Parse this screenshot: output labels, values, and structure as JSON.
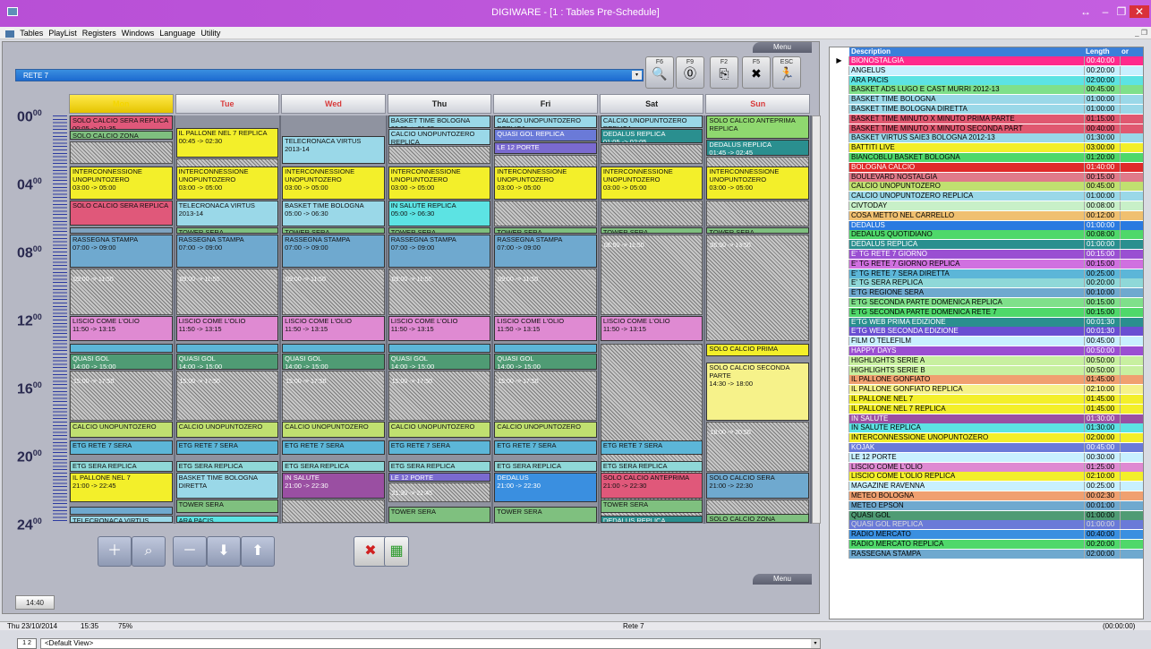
{
  "window": {
    "title": "DIGIWARE - [1 : Tables Pre-Schedule]",
    "min": "–",
    "max": "❐",
    "close": "✕",
    "restore": "↔"
  },
  "menu": [
    "Tables",
    "PlayList",
    "Registers",
    "Windows",
    "Language",
    "Utility"
  ],
  "mdi": "_ ❐",
  "menu_tab": "Menu",
  "channel": "RETE 7",
  "fbuttons": [
    {
      "key": "F6",
      "icon": "🔍"
    },
    {
      "key": "F9",
      "icon": "⓪"
    },
    {
      "key": "F2",
      "icon": "⎘"
    },
    {
      "key": "F5",
      "icon": "✖"
    },
    {
      "key": "ESC",
      "icon": "🏃"
    }
  ],
  "days": [
    "Mon",
    "Tue",
    "Wed",
    "Thu",
    "Fri",
    "Sat",
    "Sun"
  ],
  "day_colors": [
    "#f4d600",
    "#d83b3b",
    "#d83b3b",
    "#222222",
    "#222222",
    "#222222",
    "#d83b3b"
  ],
  "hours": [
    "00",
    "04",
    "08",
    "12",
    "16",
    "20",
    "24"
  ],
  "hour_sup": "00",
  "schedule": [
    [
      {
        "s": 0,
        "e": 0.9,
        "t": "SOLO CALCIO SERA REPLICA",
        "sub": "00:05 -> 01:35",
        "c": "#e0587a"
      },
      {
        "s": 0.9,
        "e": 1.5,
        "t": "SOLO CALCIO ZONA",
        "c": "#7fc07f"
      },
      {
        "s": 1.5,
        "e": 2.9,
        "h": true
      },
      {
        "s": 3,
        "e": 5,
        "t": "INTERCONNESSIONE UNOPUNTOZERO",
        "sub": "03:00 -> 05:00",
        "c": "#f3ef2a"
      },
      {
        "s": 5,
        "e": 6.5,
        "t": "SOLO CALCIO SERA REPLICA",
        "c": "#e0587a"
      },
      {
        "s": 6.6,
        "e": 7,
        "t": "",
        "c": "#7fa3c0"
      },
      {
        "s": 7,
        "e": 9,
        "t": "RASSEGNA STAMPA",
        "sub": "07:00 -> 09:00",
        "c": "#6fa9cf"
      },
      {
        "s": 9,
        "e": 11.8,
        "h": true,
        "ht": "09:00 -> 11:50"
      },
      {
        "s": 11.8,
        "e": 13.3,
        "t": "LISCIO COME L'OLIO",
        "sub": "11:50 -> 13:15",
        "c": "#df8ad2"
      },
      {
        "s": 13.4,
        "e": 14,
        "t": "",
        "c": "#5cb6d8"
      },
      {
        "s": 14,
        "e": 15,
        "t": "QUASI GOL",
        "sub": "14:00 -> 15:00",
        "c": "#4f9b74"
      },
      {
        "s": 15,
        "e": 18,
        "h": true,
        "ht": "15:00 -> 17:50"
      },
      {
        "s": 18,
        "e": 19,
        "t": "CALCIO UNOPUNTOZERO",
        "c": "#c0e070"
      },
      {
        "s": 19.1,
        "e": 20,
        "t": "ETG RETE 7 SERA",
        "c": "#5cb6d8"
      },
      {
        "s": 20.3,
        "e": 21,
        "t": "ETG SERA REPLICA",
        "c": "#8fd8d8"
      },
      {
        "s": 21,
        "e": 22.8,
        "t": "IL PALLONE NEL 7",
        "sub": "21:00 -> 22:45",
        "c": "#f3ef2a"
      },
      {
        "s": 23,
        "e": 23.5,
        "t": "",
        "c": "#6fa9cf"
      },
      {
        "s": 23.5,
        "e": 24,
        "t": "TELECRONACA VIRTUS",
        "c": "#9ad8e8"
      }
    ],
    [
      {
        "s": 0.75,
        "e": 2.5,
        "t": "IL PALLONE NEL 7 REPLICA",
        "sub": "00:45 -> 02:30",
        "c": "#f3ef2a"
      },
      {
        "s": 2.5,
        "e": 2.9,
        "h": true
      },
      {
        "s": 3,
        "e": 5,
        "t": "INTERCONNESSIONE UNOPUNTOZERO",
        "sub": "03:00 -> 05:00",
        "c": "#f3ef2a"
      },
      {
        "s": 5,
        "e": 6.6,
        "t": "TELECRONACA VIRTUS",
        "sub": "2013-14",
        "c": "#9ad8e8"
      },
      {
        "s": 6.6,
        "e": 7,
        "t": "TOWER SERA",
        "c": "#7fc07f"
      },
      {
        "s": 7,
        "e": 9,
        "t": "RASSEGNA STAMPA",
        "sub": "07:00 -> 09:00",
        "c": "#6fa9cf"
      },
      {
        "s": 9,
        "e": 11.8,
        "h": true,
        "ht": "09:00 -> 11:50"
      },
      {
        "s": 11.8,
        "e": 13.3,
        "t": "LISCIO COME L'OLIO",
        "sub": "11:50 -> 13:15",
        "c": "#df8ad2"
      },
      {
        "s": 13.4,
        "e": 14,
        "t": "",
        "c": "#5cb6d8"
      },
      {
        "s": 14,
        "e": 15,
        "t": "QUASI GOL",
        "sub": "14:00 -> 15:00",
        "c": "#4f9b74"
      },
      {
        "s": 15,
        "e": 18,
        "h": true,
        "ht": "15:00 -> 17:50"
      },
      {
        "s": 18,
        "e": 19,
        "t": "CALCIO UNOPUNTOZERO",
        "c": "#c0e070"
      },
      {
        "s": 19.1,
        "e": 20,
        "t": "ETG RETE 7 SERA",
        "c": "#5cb6d8"
      },
      {
        "s": 20.3,
        "e": 21,
        "t": "ETG SERA REPLICA",
        "c": "#8fd8d8"
      },
      {
        "s": 21,
        "e": 22.6,
        "t": "BASKET TIME BOLOGNA DIRETTA",
        "c": "#9ad8e8"
      },
      {
        "s": 22.6,
        "e": 23.4,
        "t": "TOWER SERA",
        "c": "#7fc07f"
      },
      {
        "s": 23.5,
        "e": 24,
        "t": "ARA PACIS",
        "c": "#5ce3e3"
      }
    ],
    [
      {
        "s": 1.2,
        "e": 2.9,
        "t": "TELECRONACA VIRTUS",
        "sub": "2013-14",
        "c": "#9ad8e8"
      },
      {
        "s": 3,
        "e": 5,
        "t": "INTERCONNESSIONE UNOPUNTOZERO",
        "sub": "03:00 -> 05:00",
        "c": "#f3ef2a"
      },
      {
        "s": 5,
        "e": 6.6,
        "t": "BASKET TIME BOLOGNA",
        "sub": "05:00 -> 06:30",
        "c": "#9ad8e8"
      },
      {
        "s": 6.6,
        "e": 7,
        "t": "TOWER SERA",
        "c": "#7fc07f"
      },
      {
        "s": 7,
        "e": 9,
        "t": "RASSEGNA STAMPA",
        "sub": "07:00 -> 09:00",
        "c": "#6fa9cf"
      },
      {
        "s": 9,
        "e": 11.8,
        "h": true,
        "ht": "09:00 -> 11:50"
      },
      {
        "s": 11.8,
        "e": 13.3,
        "t": "LISCIO COME L'OLIO",
        "sub": "11:50 -> 13:15",
        "c": "#df8ad2"
      },
      {
        "s": 13.4,
        "e": 14,
        "t": "",
        "c": "#5cb6d8"
      },
      {
        "s": 14,
        "e": 15,
        "t": "QUASI GOL",
        "sub": "14:00 -> 15:00",
        "c": "#4f9b74"
      },
      {
        "s": 15,
        "e": 18,
        "h": true,
        "ht": "15:00 -> 17:50"
      },
      {
        "s": 18,
        "e": 19,
        "t": "CALCIO UNOPUNTOZERO",
        "c": "#c0e070"
      },
      {
        "s": 19.1,
        "e": 20,
        "t": "ETG RETE 7 SERA",
        "c": "#5cb6d8"
      },
      {
        "s": 20.3,
        "e": 21,
        "t": "ETG SERA REPLICA",
        "c": "#8fd8d8"
      },
      {
        "s": 21,
        "e": 22.6,
        "t": "IN SALUTE",
        "sub": "21:00 -> 22:30",
        "c": "#9a4fa2"
      },
      {
        "s": 22.6,
        "e": 24,
        "h": true
      }
    ],
    [
      {
        "s": 0,
        "e": 0.8,
        "t": "BASKET TIME BOLOGNA",
        "sub": "00:05 -> 01:05",
        "c": "#9ad8e8"
      },
      {
        "s": 0.8,
        "e": 1.8,
        "t": "CALCIO UNOPUNTOZERO REPLICA",
        "c": "#9ad8e8"
      },
      {
        "s": 1.8,
        "e": 2.9,
        "h": true
      },
      {
        "s": 3,
        "e": 5,
        "t": "INTERCONNESSIONE UNOPUNTOZERO",
        "sub": "03:00 -> 05:00",
        "c": "#f3ef2a"
      },
      {
        "s": 5,
        "e": 6.6,
        "t": "IN SALUTE REPLICA",
        "sub": "05:00 -> 06:30",
        "c": "#5ce3e3"
      },
      {
        "s": 6.6,
        "e": 7,
        "t": "TOWER SERA",
        "c": "#7fc07f"
      },
      {
        "s": 7,
        "e": 9,
        "t": "RASSEGNA STAMPA",
        "sub": "07:00 -> 09:00",
        "c": "#6fa9cf"
      },
      {
        "s": 9,
        "e": 11.8,
        "h": true,
        "ht": "09:00 -> 11:50"
      },
      {
        "s": 11.8,
        "e": 13.3,
        "t": "LISCIO COME L'OLIO",
        "sub": "11:50 -> 13:15",
        "c": "#df8ad2"
      },
      {
        "s": 13.4,
        "e": 14,
        "t": "",
        "c": "#5cb6d8"
      },
      {
        "s": 14,
        "e": 15,
        "t": "QUASI GOL",
        "sub": "14:00 -> 15:00",
        "c": "#4f9b74"
      },
      {
        "s": 15,
        "e": 18,
        "h": true,
        "ht": "15:00 -> 17:50"
      },
      {
        "s": 18,
        "e": 19,
        "t": "CALCIO UNOPUNTOZERO",
        "c": "#c0e070"
      },
      {
        "s": 19.1,
        "e": 20,
        "t": "ETG RETE 7 SERA",
        "c": "#5cb6d8"
      },
      {
        "s": 20.3,
        "e": 21,
        "t": "ETG SERA REPLICA",
        "c": "#8fd8d8"
      },
      {
        "s": 21,
        "e": 21.6,
        "t": "LE 12 PORTE",
        "c": "#7a6ad0"
      },
      {
        "s": 21.6,
        "e": 22.8,
        "h": true,
        "ht": "21:30 -> 22:45"
      },
      {
        "s": 23,
        "e": 24,
        "t": "TOWER SERA",
        "c": "#7fc07f"
      }
    ],
    [
      {
        "s": 0,
        "e": 0.8,
        "t": "CALCIO UNOPUNTOZERO REPLICA",
        "c": "#9ad8e8"
      },
      {
        "s": 0.8,
        "e": 1.6,
        "t": "QUASI GOL REPLICA",
        "c": "#6a7ad8"
      },
      {
        "s": 1.6,
        "e": 2.3,
        "t": "LE 12 PORTE",
        "c": "#7a6ad0"
      },
      {
        "s": 2.3,
        "e": 2.9,
        "h": true
      },
      {
        "s": 3,
        "e": 5,
        "t": "INTERCONNESSIONE UNOPUNTOZERO",
        "sub": "03:00 -> 05:00",
        "c": "#f3ef2a"
      },
      {
        "s": 5,
        "e": 6.6,
        "h": true
      },
      {
        "s": 6.6,
        "e": 7,
        "t": "TOWER SERA",
        "c": "#7fc07f"
      },
      {
        "s": 7,
        "e": 9,
        "t": "RASSEGNA STAMPA",
        "sub": "07:00 -> 09:00",
        "c": "#6fa9cf"
      },
      {
        "s": 9,
        "e": 11.8,
        "h": true,
        "ht": "09:00 -> 11:50"
      },
      {
        "s": 11.8,
        "e": 13.3,
        "t": "LISCIO COME L'OLIO",
        "sub": "11:50 -> 13:15",
        "c": "#df8ad2"
      },
      {
        "s": 13.4,
        "e": 14,
        "t": "",
        "c": "#5cb6d8"
      },
      {
        "s": 14,
        "e": 15,
        "t": "QUASI GOL",
        "sub": "14:00 -> 15:00",
        "c": "#4f9b74"
      },
      {
        "s": 15,
        "e": 18,
        "h": true,
        "ht": "15:00 -> 17:50"
      },
      {
        "s": 18,
        "e": 19,
        "t": "CALCIO UNOPUNTOZERO",
        "c": "#c0e070"
      },
      {
        "s": 19.1,
        "e": 20,
        "t": "ETG RETE 7 SERA",
        "c": "#5cb6d8"
      },
      {
        "s": 20.3,
        "e": 21,
        "t": "ETG SERA REPLICA",
        "c": "#8fd8d8"
      },
      {
        "s": 21,
        "e": 22.8,
        "t": "DEDALUS",
        "sub": "21:00 -> 22:30",
        "c": "#3a8fe0"
      },
      {
        "s": 23,
        "e": 24,
        "t": "TOWER SERA",
        "c": "#7fc07f"
      }
    ],
    [
      {
        "s": 0,
        "e": 0.8,
        "t": "CALCIO UNOPUNTOZERO REPLICA",
        "c": "#9ad8e8"
      },
      {
        "s": 0.8,
        "e": 1.7,
        "t": "DEDALUS REPLICA",
        "sub": "01:05 -> 02:05",
        "c": "#2a8f8f"
      },
      {
        "s": 1.7,
        "e": 2.9,
        "h": true
      },
      {
        "s": 3,
        "e": 5,
        "t": "INTERCONNESSIONE UNOPUNTOZERO",
        "sub": "03:00 -> 05:00",
        "c": "#f3ef2a"
      },
      {
        "s": 5,
        "e": 6.6,
        "h": true
      },
      {
        "s": 6.6,
        "e": 7,
        "t": "TOWER SERA",
        "c": "#7fc07f"
      },
      {
        "s": 7,
        "e": 11.8,
        "h": true,
        "ht": "06:50 -> 11:50"
      },
      {
        "s": 11.8,
        "e": 13.3,
        "t": "LISCIO COME L'OLIO",
        "sub": "11:50 -> 13:15",
        "c": "#df8ad2"
      },
      {
        "s": 13.4,
        "e": 24,
        "h": true
      },
      {
        "s": 19.1,
        "e": 20,
        "t": "ETG RETE 7 SERA",
        "c": "#5cb6d8"
      },
      {
        "s": 20.3,
        "e": 21,
        "t": "ETG SERA REPLICA",
        "c": "#8fd8d8"
      },
      {
        "s": 21,
        "e": 22.6,
        "t": "SOLO CALCIO ANTEPRIMA",
        "sub": "21:00 -> 22:30",
        "c": "#e0587a"
      },
      {
        "s": 22.6,
        "e": 23.4,
        "t": "TOWER SERA",
        "c": "#7fc07f"
      },
      {
        "s": 23.5,
        "e": 24,
        "t": "DEDALUS REPLICA",
        "c": "#2a8f8f"
      }
    ],
    [
      {
        "s": 0,
        "e": 1.4,
        "t": "SOLO CALCIO ANTEPRIMA REPLICA",
        "c": "#8fd86f"
      },
      {
        "s": 1.4,
        "e": 2.4,
        "t": "DEDALUS REPLICA",
        "sub": "01:45 -> 02:45",
        "c": "#2a8f8f"
      },
      {
        "s": 2.4,
        "e": 2.9,
        "h": true
      },
      {
        "s": 3,
        "e": 5,
        "t": "INTERCONNESSIONE UNOPUNTOZERO",
        "sub": "03:00 -> 05:00",
        "c": "#f3ef2a"
      },
      {
        "s": 5,
        "e": 6.6,
        "h": true
      },
      {
        "s": 6.6,
        "e": 7,
        "t": "TOWER SERA",
        "c": "#7fc07f"
      },
      {
        "s": 7,
        "e": 13.3,
        "h": true,
        "ht": "06:50 -> 13:50"
      },
      {
        "s": 13.4,
        "e": 14.2,
        "t": "SOLO CALCIO PRIMA",
        "c": "#f3ef2a"
      },
      {
        "s": 14.5,
        "e": 18,
        "t": "SOLO CALCIO SECONDA PARTE",
        "sub": "14:30 -> 18:00",
        "c": "#f6f28a"
      },
      {
        "s": 18,
        "e": 21,
        "h": true,
        "ht": "18:00 -> 20:50"
      },
      {
        "s": 21,
        "e": 22.6,
        "t": "SOLO CALCIO SERA",
        "sub": "21:00 -> 22:30",
        "c": "#6fa9cf"
      },
      {
        "s": 22.6,
        "e": 23.4,
        "h": true
      },
      {
        "s": 23.4,
        "e": 24,
        "t": "SOLO CALCIO ZONA",
        "c": "#7fc07f"
      }
    ]
  ],
  "clock": "14:40",
  "toolbar": [
    {
      "name": "zoom-in-button",
      "icon": "＋"
    },
    {
      "name": "zoom-button",
      "icon": "⌕"
    },
    {
      "name": "zoom-out-button",
      "icon": "－"
    },
    {
      "name": "move-down-button",
      "icon": "⬇"
    },
    {
      "name": "move-up-button",
      "icon": "⬆"
    }
  ],
  "delete_icon": "✖",
  "export_icon": "▦",
  "pager": "1 2",
  "view": "<Default View>",
  "dd": "▾",
  "list_header": {
    "desc": "Description",
    "len": "Length",
    "oth": "or"
  },
  "list_pointer": "▶",
  "list": [
    {
      "d": "BIONOSTALGIA",
      "l": "00:40:00",
      "c": "#ff2a8c",
      "t": "#fff"
    },
    {
      "d": "ANGELUS",
      "l": "00:20:00",
      "c": "#c8f0ff"
    },
    {
      "d": "ARA PACIS",
      "l": "02:00:00",
      "c": "#5ce3e3"
    },
    {
      "d": "BASKET  ADS LUGO E  CAST MURRI 2012-13",
      "l": "00:45:00",
      "c": "#7fe08a"
    },
    {
      "d": "BASKET TIME BOLOGNA",
      "l": "01:00:00",
      "c": "#9ad8e8"
    },
    {
      "d": "BASKET TIME BOLOGNA DIRETTA",
      "l": "01:00:00",
      "c": "#9ad8e8"
    },
    {
      "d": "BASKET TIME MINUTO X MINUTO PRIMA PARTE",
      "l": "01:15:00",
      "c": "#e05870"
    },
    {
      "d": "BASKET TIME MINUTO X MINUTO SECONDA PART",
      "l": "00:40:00",
      "c": "#e05870"
    },
    {
      "d": "BASKET VIRTUS SAIE3 BOLOGNA 2012-13",
      "l": "01:30:00",
      "c": "#9ad8e8"
    },
    {
      "d": "BATTITI LIVE",
      "l": "03:00:00",
      "c": "#f3ef2a"
    },
    {
      "d": "BIANCOBLU BASKET BOLOGNA",
      "l": "01:20:00",
      "c": "#4fd86a"
    },
    {
      "d": "BOLOGNA CALCIO",
      "l": "01:40:00",
      "c": "#e02a2a",
      "t": "#fff"
    },
    {
      "d": "BOULEVARD NOSTALGIA",
      "l": "00:15:00",
      "c": "#e07a8a"
    },
    {
      "d": "CALCIO UNOPUNTOZERO",
      "l": "00:45:00",
      "c": "#c0e070"
    },
    {
      "d": "CALCIO UNOPUNTOZERO REPLICA",
      "l": "01:00:00",
      "c": "#9ad8e8"
    },
    {
      "d": "CIVTODAY",
      "l": "00:08:00",
      "c": "#c8f0c8"
    },
    {
      "d": "COSA METTO NEL CARRELLO",
      "l": "00:12:00",
      "c": "#f0c070"
    },
    {
      "d": "DEDALUS",
      "l": "01:00:00",
      "c": "#2a7ae0",
      "t": "#fff"
    },
    {
      "d": "DEDALUS QUOTIDIANO",
      "l": "00:08:00",
      "c": "#4fd86a"
    },
    {
      "d": "DEDALUS REPLICA",
      "l": "01:00:00",
      "c": "#2a8f8f",
      "t": "#fff"
    },
    {
      "d": "E' TG RETE 7 GIORNO",
      "l": "00:15:00",
      "c": "#9a4fd2",
      "t": "#fff"
    },
    {
      "d": "E' TG RETE 7 GIORNO REPLICA",
      "l": "00:15:00",
      "c": "#d070e0"
    },
    {
      "d": "E' TG RETE 7 SERA DIRETTA",
      "l": "00:25:00",
      "c": "#5cb6d8"
    },
    {
      "d": "E' TG SERA REPLICA",
      "l": "00:20:00",
      "c": "#8fd8d8"
    },
    {
      "d": "E'TG REGIONE SERA",
      "l": "00:10:00",
      "c": "#6fa9cf"
    },
    {
      "d": "E'TG SECONDA PARTE DOMENICA REPLICA",
      "l": "00:15:00",
      "c": "#7fe08a"
    },
    {
      "d": "E'TG SECONDA PARTE DOMENICA RETE 7",
      "l": "00:15:00",
      "c": "#4fd86a"
    },
    {
      "d": "E'TG WEB PRIMA EDIZIONE",
      "l": "00:01:30",
      "c": "#2a8f8f",
      "t": "#fff"
    },
    {
      "d": "E'TG WEB SECONDA EDIZIONE",
      "l": "00:01:30",
      "c": "#6a4fd2",
      "t": "#fff"
    },
    {
      "d": "FILM O TELEFILM",
      "l": "00:45:00",
      "c": "#c8f0ff"
    },
    {
      "d": "HAPPY DAYS",
      "l": "00:50:00",
      "c": "#9a4fd2",
      "t": "#fff"
    },
    {
      "d": "HIGHLIGHTS SERIE A",
      "l": "00:50:00",
      "c": "#c8f0a0"
    },
    {
      "d": "HIGHLIGHTS SERIE B",
      "l": "00:50:00",
      "c": "#c8f0a0"
    },
    {
      "d": "IL PALLONE GONFIATO",
      "l": "01:45:00",
      "c": "#f0a070"
    },
    {
      "d": "IL PALLONE GONFIATO REPLICA",
      "l": "02:10:00",
      "c": "#f6f28a"
    },
    {
      "d": "IL PALLONE NEL 7",
      "l": "01:45:00",
      "c": "#f3ef2a"
    },
    {
      "d": "IL PALLONE NEL 7 REPLICA",
      "l": "01:45:00",
      "c": "#f3ef2a"
    },
    {
      "d": "IN SALUTE",
      "l": "01:30:00",
      "c": "#9a4fa2",
      "t": "#fff"
    },
    {
      "d": "IN SALUTE REPLICA",
      "l": "01:30:00",
      "c": "#5ce3e3"
    },
    {
      "d": "INTERCONNESSIONE UNOPUNTOZERO",
      "l": "02:00:00",
      "c": "#f3ef2a"
    },
    {
      "d": "KOJAK",
      "l": "00:45:00",
      "c": "#6a7ad8",
      "t": "#fff"
    },
    {
      "d": "LE 12 PORTE",
      "l": "00:30:00",
      "c": "#c8f0ff"
    },
    {
      "d": "LISCIO COME L'OLIO",
      "l": "01:25:00",
      "c": "#df8ad2"
    },
    {
      "d": "LISCIO COME L'OLIO REPLICA",
      "l": "02:10:00",
      "c": "#f3ef2a"
    },
    {
      "d": "MAGAZINE RAVENNA",
      "l": "00:25:00",
      "c": "#c8f0ff"
    },
    {
      "d": "METEO BOLOGNA",
      "l": "00:02:30",
      "c": "#f0a070"
    },
    {
      "d": "METEO EPSON",
      "l": "00:01:00",
      "c": "#6fa9cf"
    },
    {
      "d": "QUASI GOL",
      "l": "01:00:00",
      "c": "#4f9b74"
    },
    {
      "d": "QUASI GOL REPLICA",
      "l": "01:00:00",
      "c": "#6a7ad8",
      "t": "#ddd"
    },
    {
      "d": "RADIO MERCATO",
      "l": "00:40:00",
      "c": "#3a8fe0"
    },
    {
      "d": "RADIO MERCATO REPLICA",
      "l": "00:20:00",
      "c": "#4fd86a"
    },
    {
      "d": "RASSEGNA STAMPA",
      "l": "02:00:00",
      "c": "#6fa9cf"
    }
  ],
  "status": {
    "date": "Thu 23/10/2014",
    "time": "15:35",
    "zoom": "75%",
    "channel": "Rete 7",
    "total": "(00:00:00)"
  }
}
